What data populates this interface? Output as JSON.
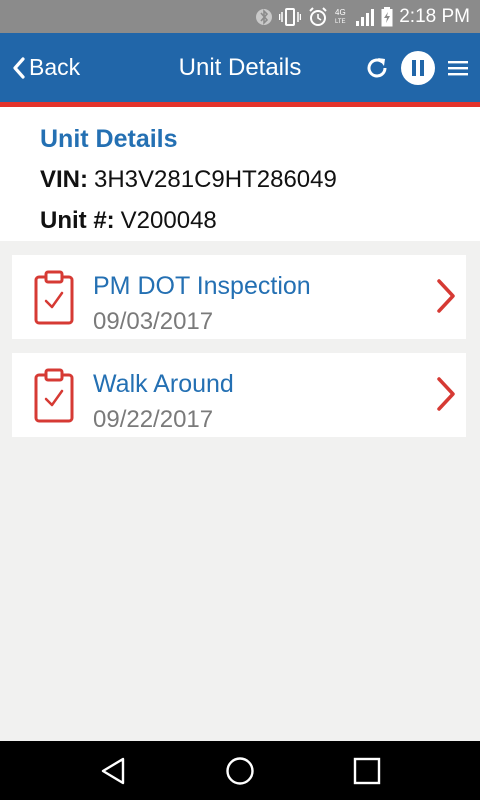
{
  "status_bar": {
    "time": "2:18 PM",
    "icons": [
      "bluetooth-icon",
      "vibrate-icon",
      "alarm-icon",
      "lte-icon",
      "signal-icon",
      "battery-charging-icon"
    ]
  },
  "app_bar": {
    "back_label": "Back",
    "title": "Unit Details",
    "actions": [
      "refresh-icon",
      "pause-icon",
      "menu-icon"
    ]
  },
  "details": {
    "title": "Unit Details",
    "vin_label": "VIN:",
    "vin_value": "3H3V281C9HT286049",
    "unit_label": "Unit #:",
    "unit_value": "V200048"
  },
  "inspections": [
    {
      "title": "PM DOT Inspection",
      "date": "09/03/2017"
    },
    {
      "title": "Walk Around",
      "date": "09/22/2017"
    }
  ],
  "colors": {
    "app_bar": "#2166a9",
    "accent": "#e3322b",
    "link_blue": "#2470b3",
    "icon_red": "#d63a34"
  }
}
